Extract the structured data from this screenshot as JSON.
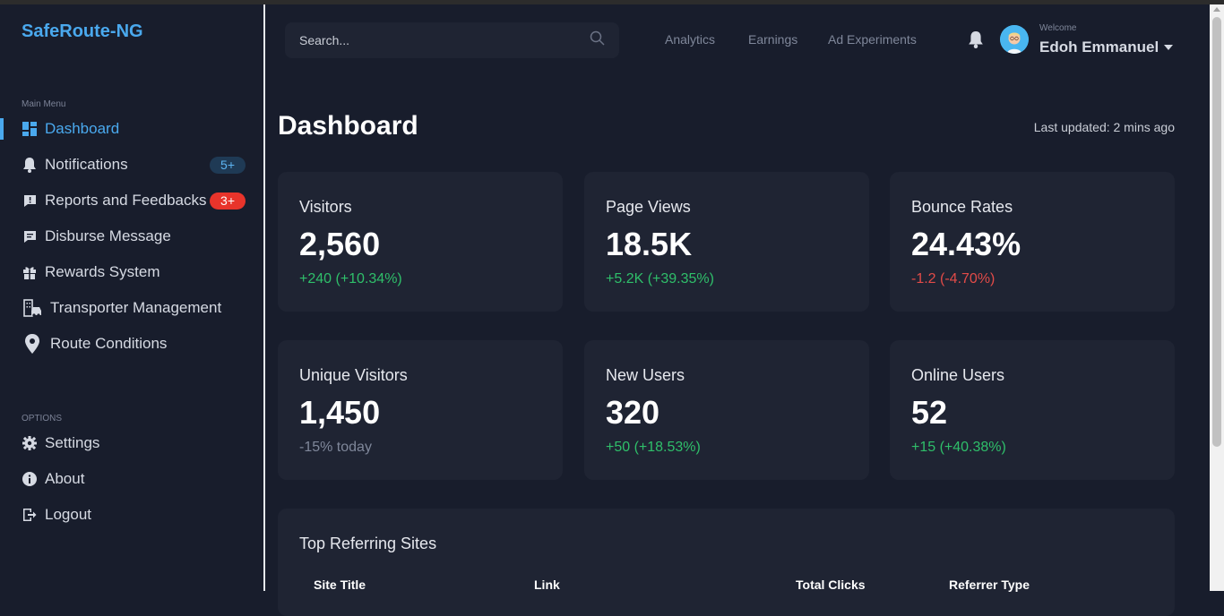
{
  "brand": "SafeRoute-NG",
  "sidebar": {
    "main_menu_label": "Main Menu",
    "items": [
      {
        "label": "Dashboard",
        "icon": "dashboard-grid-icon"
      },
      {
        "label": "Notifications",
        "icon": "bell-icon",
        "badge": "5+"
      },
      {
        "label": "Reports and Feedbacks",
        "icon": "report-icon",
        "badge": "3+"
      },
      {
        "label": "Disburse Message",
        "icon": "message-icon"
      },
      {
        "label": "Rewards System",
        "icon": "gift-icon"
      },
      {
        "label": "Transporter Management",
        "icon": "building-car-icon"
      },
      {
        "label": "Route Conditions",
        "icon": "map-pin-icon"
      }
    ],
    "options_label": "OPTIONS",
    "options": [
      {
        "label": "Settings",
        "icon": "gear-icon"
      },
      {
        "label": "About",
        "icon": "info-icon"
      },
      {
        "label": "Logout",
        "icon": "logout-icon"
      }
    ]
  },
  "header": {
    "search_placeholder": "Search...",
    "links": [
      "Analytics",
      "Earnings",
      "Ad Experiments"
    ],
    "welcome": "Welcome",
    "username": "Edoh Emmanuel"
  },
  "main": {
    "title": "Dashboard",
    "last_updated": "Last updated: 2 mins ago",
    "stats": [
      {
        "label": "Visitors",
        "value": "2,560",
        "delta": "+240 (+10.34%)",
        "trend": "up"
      },
      {
        "label": "Page Views",
        "value": "18.5K",
        "delta": "+5.2K (+39.35%)",
        "trend": "up"
      },
      {
        "label": "Bounce Rates",
        "value": "24.43%",
        "delta": "-1.2 (-4.70%)",
        "trend": "down"
      },
      {
        "label": "Unique Visitors",
        "value": "1,450",
        "delta": "-15% today",
        "trend": "neutral"
      },
      {
        "label": "New Users",
        "value": "320",
        "delta": "+50 (+18.53%)",
        "trend": "up"
      },
      {
        "label": "Online Users",
        "value": "52",
        "delta": "+15 (+40.38%)",
        "trend": "up"
      }
    ],
    "referring": {
      "title": "Top Referring Sites",
      "columns": [
        "Site Title",
        "Link",
        "Total Clicks",
        "Referrer Type"
      ]
    }
  },
  "colors": {
    "accent": "#4aa9ee",
    "background": "#181d2c",
    "card": "#1f2433",
    "positive": "#2fbf6a",
    "negative": "#e24b48",
    "neutral": "#7f879a"
  }
}
